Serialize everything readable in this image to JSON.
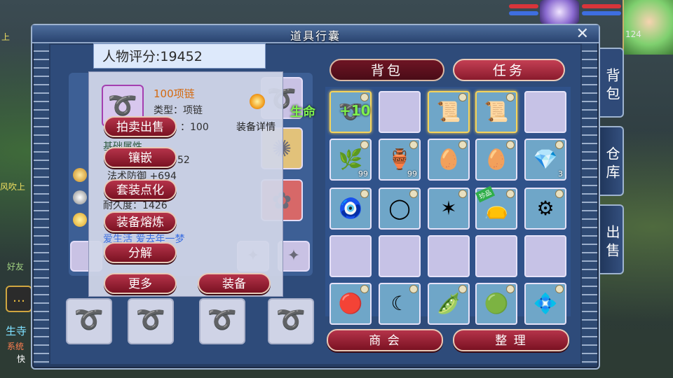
{
  "window": {
    "title": "道具行囊",
    "close_label": "✕"
  },
  "background": {
    "left_texts": [
      "上",
      "风吹上",
      "好友",
      "生寺",
      "系统",
      "快"
    ],
    "right_numbers": [
      "124"
    ]
  },
  "character": {
    "score_label": "人物评分:",
    "score_value": "19452"
  },
  "tooltip": {
    "item_name": "100项链",
    "type_line": "类型：项链",
    "level_line": "：100",
    "detail_label": "装备详情",
    "base_attr_line": "基础属性",
    "attr_line_1": "52",
    "attr_line_2": "法术防御 +694",
    "durability_line": "耐久度：1426",
    "set_line": "爱生活 爱去年一梦",
    "buttons": {
      "auction": "拍卖出售",
      "inlay": "镶嵌",
      "set_enchant": "套装点化",
      "smelt": "装备熔炼",
      "decompose": "分解",
      "more": "更多",
      "equip": "装备"
    }
  },
  "tabs": {
    "bag": "背包",
    "task": "任务"
  },
  "side_tabs": [
    "背包",
    "仓库",
    "出售"
  ],
  "inventory": {
    "life_label": "生命",
    "plus_label": "+10",
    "cells": [
      {
        "icon": "necklace-icon",
        "glyph": "➰",
        "qty": "",
        "filled": true,
        "sel": true
      },
      {
        "icon": "",
        "glyph": "",
        "qty": "",
        "filled": false,
        "sel": false
      },
      {
        "icon": "scroll-icon",
        "glyph": "📜",
        "qty": "",
        "filled": true,
        "sel": true
      },
      {
        "icon": "scroll-icon",
        "glyph": "📜",
        "qty": "",
        "filled": true,
        "sel": true
      },
      {
        "icon": "",
        "glyph": "",
        "qty": "",
        "filled": false,
        "sel": false
      },
      {
        "icon": "herb-icon",
        "glyph": "🌿",
        "qty": "99",
        "filled": true,
        "sel": false
      },
      {
        "icon": "vase-icon",
        "glyph": "🏺",
        "qty": "99",
        "filled": true,
        "sel": false
      },
      {
        "icon": "egg-icon",
        "glyph": "🥚",
        "qty": "",
        "filled": true,
        "sel": false
      },
      {
        "icon": "egg-icon",
        "glyph": "🥚",
        "qty": "",
        "filled": true,
        "sel": false
      },
      {
        "icon": "crystal-icon",
        "glyph": "💎",
        "qty": "3",
        "filled": true,
        "sel": false
      },
      {
        "icon": "amulet-icon",
        "glyph": "🧿",
        "qty": "",
        "filled": true,
        "sel": false
      },
      {
        "icon": "ring-icon",
        "glyph": "◯",
        "qty": "",
        "filled": true,
        "sel": false
      },
      {
        "icon": "star-gem-icon",
        "glyph": "✶",
        "qty": "",
        "filled": true,
        "sel": false
      },
      {
        "icon": "pouch-icon",
        "glyph": "👝",
        "qty": "",
        "filled": true,
        "sel": false,
        "badge": "珍品"
      },
      {
        "icon": "treasure-icon",
        "glyph": "⚙",
        "qty": "",
        "filled": true,
        "sel": false
      },
      {
        "icon": "",
        "glyph": "",
        "qty": "",
        "filled": false,
        "sel": false
      },
      {
        "icon": "",
        "glyph": "",
        "qty": "",
        "filled": false,
        "sel": false
      },
      {
        "icon": "",
        "glyph": "",
        "qty": "",
        "filled": false,
        "sel": false
      },
      {
        "icon": "",
        "glyph": "",
        "qty": "",
        "filled": false,
        "sel": false
      },
      {
        "icon": "",
        "glyph": "",
        "qty": "",
        "filled": false,
        "sel": false
      },
      {
        "icon": "red-orb-icon",
        "glyph": "🔴",
        "qty": "",
        "filled": true,
        "sel": false
      },
      {
        "icon": "blue-crescent-icon",
        "glyph": "☾",
        "qty": "",
        "filled": true,
        "sel": false
      },
      {
        "icon": "green-beans-icon",
        "glyph": "🫛",
        "qty": "",
        "filled": true,
        "sel": false
      },
      {
        "icon": "green-orb-icon",
        "glyph": "🟢",
        "qty": "",
        "filled": true,
        "sel": false
      },
      {
        "icon": "silver-gem-icon",
        "glyph": "💠",
        "qty": "",
        "filled": true,
        "sel": false
      }
    ]
  },
  "footer": {
    "shop_label": "商 会",
    "sort_label": "整 理"
  }
}
